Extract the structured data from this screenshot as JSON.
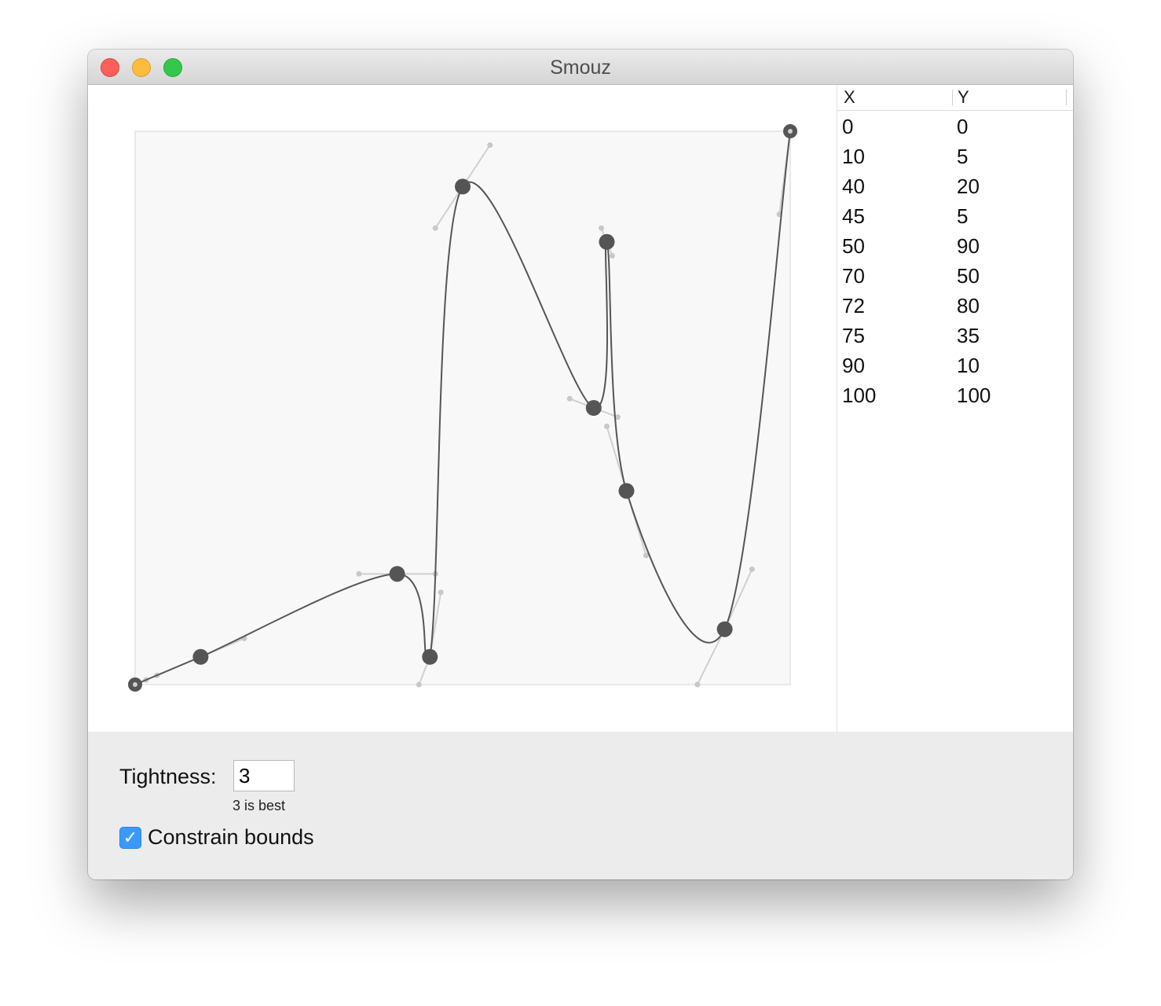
{
  "window": {
    "title": "Smouz"
  },
  "table": {
    "headers": {
      "x": "X",
      "y": "Y"
    },
    "rows": [
      {
        "x": "0",
        "y": "0"
      },
      {
        "x": "10",
        "y": "5"
      },
      {
        "x": "40",
        "y": "20"
      },
      {
        "x": "45",
        "y": "5"
      },
      {
        "x": "50",
        "y": "90"
      },
      {
        "x": "70",
        "y": "50"
      },
      {
        "x": "72",
        "y": "80"
      },
      {
        "x": "75",
        "y": "35"
      },
      {
        "x": "90",
        "y": "10"
      },
      {
        "x": "100",
        "y": "100"
      }
    ]
  },
  "controls": {
    "tightness_label": "Tightness:",
    "tightness_value": "3",
    "tightness_hint": "3 is best",
    "constrain_label": "Constrain bounds",
    "constrain_checked": true
  },
  "chart_data": {
    "type": "line",
    "title": "",
    "xlabel": "",
    "ylabel": "",
    "xlim": [
      0,
      100
    ],
    "ylim": [
      0,
      100
    ],
    "x": [
      0,
      10,
      40,
      45,
      50,
      70,
      72,
      75,
      90,
      100
    ],
    "y": [
      0,
      5,
      20,
      5,
      90,
      50,
      80,
      35,
      10,
      100
    ],
    "curve": "smoothed bezier through points with control-point handles",
    "colors": {
      "curve": "#555555",
      "point": "#555555",
      "handle": "#d0d0d0",
      "plot_bg": "#f8f8f8"
    }
  },
  "colors": {
    "checkbox": "#3b99fc",
    "window_bg": "#ececec"
  },
  "icons": {
    "close": "close-button",
    "minimize": "minimize-button",
    "zoom": "zoom-button",
    "check": "checkmark-icon"
  }
}
